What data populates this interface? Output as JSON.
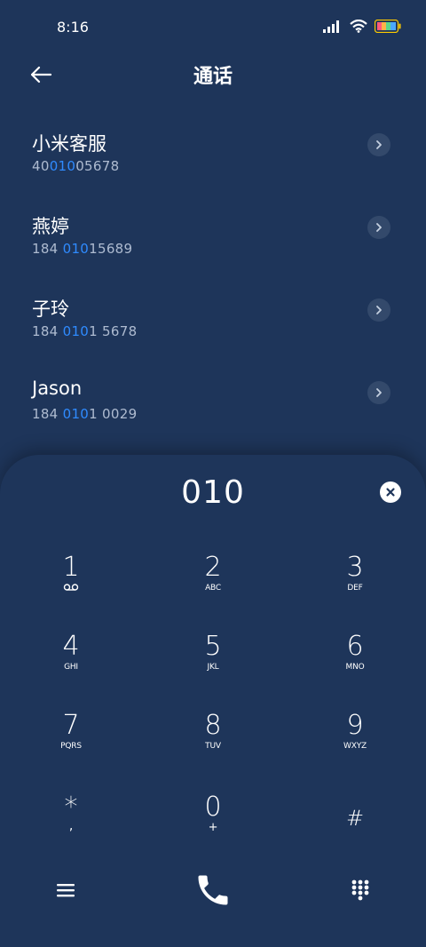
{
  "status": {
    "time": "8:16"
  },
  "header": {
    "title": "通话"
  },
  "contacts": [
    {
      "name": "小米客服",
      "number_pre": "40",
      "number_hl": "010",
      "number_post": "05678"
    },
    {
      "name": "燕婷",
      "number_pre": "184 ",
      "number_hl": "010",
      "number_post": "15689"
    },
    {
      "name": "子玲",
      "number_pre": "184 ",
      "number_hl": "010",
      "number_post": "1 5678"
    },
    {
      "name": "Jason",
      "number_pre": "184 ",
      "number_hl": "010",
      "number_post": "1 0029"
    }
  ],
  "dialpad": {
    "dialed": "010",
    "keys": [
      {
        "digit": "1",
        "letters": ""
      },
      {
        "digit": "2",
        "letters": "ABC"
      },
      {
        "digit": "3",
        "letters": "DEF"
      },
      {
        "digit": "4",
        "letters": "GHI"
      },
      {
        "digit": "5",
        "letters": "JKL"
      },
      {
        "digit": "6",
        "letters": "MNO"
      },
      {
        "digit": "7",
        "letters": "PQRS"
      },
      {
        "digit": "8",
        "letters": "TUV"
      },
      {
        "digit": "9",
        "letters": "WXYZ"
      },
      {
        "digit": "*",
        "letters": ","
      },
      {
        "digit": "0",
        "letters": "+"
      },
      {
        "digit": "#",
        "letters": ""
      }
    ]
  },
  "icons": {
    "back": "back-arrow-icon",
    "chevron": "chevron-right-icon",
    "clear": "clear-icon",
    "voicemail": "voicemail-icon",
    "menu": "menu-icon",
    "call": "phone-icon",
    "keypad": "dialpad-icon"
  },
  "colors": {
    "background": "#1e355a",
    "highlight": "#2f8bff",
    "secondary_text": "#aebbd0"
  }
}
